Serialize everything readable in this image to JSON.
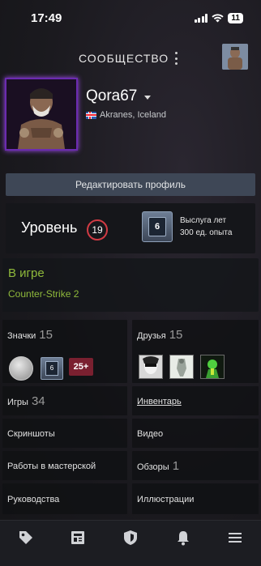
{
  "status": {
    "time": "17:49",
    "battery": "11"
  },
  "topbar": {
    "title": "СООБЩЕСТВО"
  },
  "profile": {
    "username": "Qora67",
    "location": "Akranes, Iceland"
  },
  "edit_button": "Редактировать профиль",
  "level": {
    "label": "Уровень",
    "value": "19",
    "service_badge": "6",
    "service_title": "Выслуга лет",
    "service_xp": "300 ед. опыта"
  },
  "ingame": {
    "title": "В игре",
    "game": "Counter-Strike 2"
  },
  "badges": {
    "label": "Значки",
    "count": "15",
    "items": [
      "6",
      "25+"
    ]
  },
  "friends": {
    "label": "Друзья",
    "count": "15"
  },
  "games": {
    "label": "Игры",
    "count": "34"
  },
  "inventory": {
    "label": "Инвентарь"
  },
  "screenshots": {
    "label": "Скриншоты"
  },
  "videos": {
    "label": "Видео"
  },
  "workshop": {
    "label": "Работы в мастерской"
  },
  "reviews": {
    "label": "Обзоры",
    "count": "1"
  },
  "guides": {
    "label": "Руководства"
  },
  "artwork": {
    "label": "Иллюстрации"
  },
  "tabbar": {
    "icons": [
      "tag-icon",
      "news-icon",
      "shield-icon",
      "bell-icon",
      "menu-icon"
    ]
  }
}
